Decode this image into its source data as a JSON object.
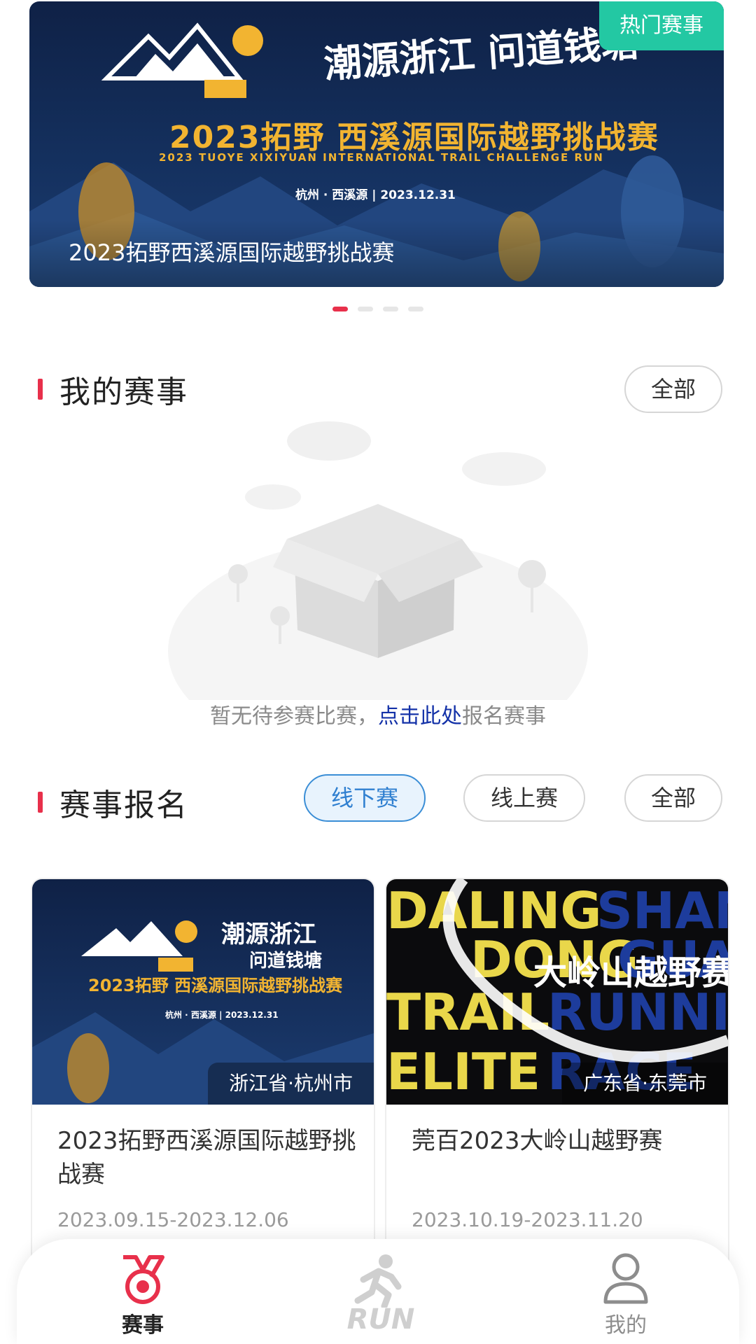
{
  "banner": {
    "badge": "热门赛事",
    "caption": "2023拓野西溪源国际越野挑战赛",
    "callig_text": "潮源浙江 问道钱塘",
    "title_cn": "2023拓野 西溪源国际越野挑战赛",
    "title_en": "2023 TUOYE XIXIYUAN INTERNATIONAL TRAIL CHALLENGE RUN",
    "loc_date": "杭州 · 西溪源 | 2023.12.31",
    "slides_total": 4,
    "active_slide": 1
  },
  "my_events": {
    "title": "我的赛事",
    "all_label": "全部",
    "empty_prefix": "暂无待参赛比赛，",
    "empty_link": "点击此处",
    "empty_suffix": "报名赛事"
  },
  "registration": {
    "title": "赛事报名",
    "filters": [
      {
        "label": "线下赛",
        "active": true
      },
      {
        "label": "线上赛",
        "active": false
      },
      {
        "label": "全部",
        "active": false
      }
    ]
  },
  "cards": [
    {
      "title": "2023拓野西溪源国际越野挑战赛",
      "date_range": "2023.09.15-2023.12.06",
      "location": "浙江省·杭州市"
    },
    {
      "title": "莞百2023大岭山越野赛",
      "date_range": "2023.10.19-2023.11.20",
      "location": "广东省·东莞市",
      "poster_big": "大岭山越野赛"
    }
  ],
  "tabbar": {
    "items": [
      {
        "label": "赛事",
        "icon": "medal-icon",
        "active": true
      },
      {
        "label": "RUN",
        "icon": "runner-icon",
        "active": false
      },
      {
        "label": "我的",
        "icon": "user-icon",
        "active": false
      }
    ],
    "colors": {
      "accent": "#e8304b",
      "inactive": "#8d8d8d"
    }
  }
}
